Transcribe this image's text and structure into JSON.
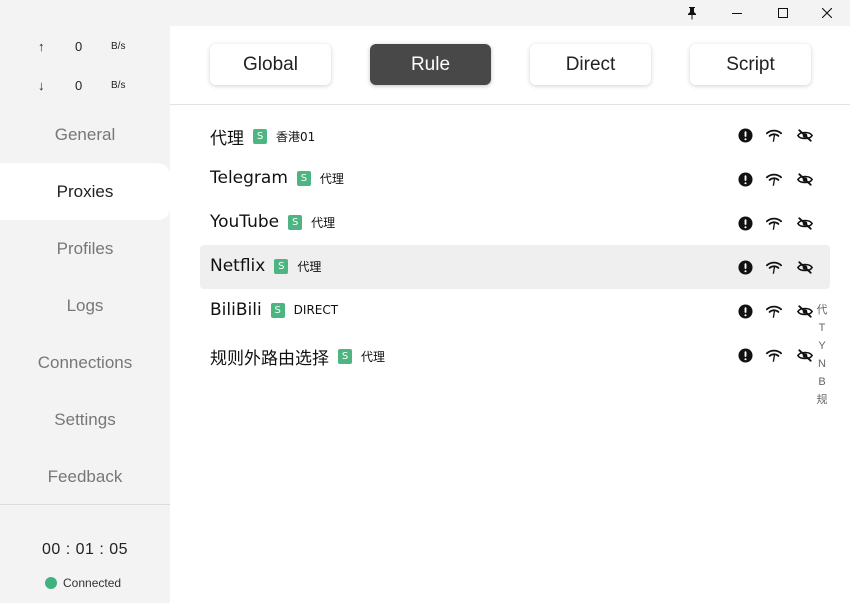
{
  "titlebar": {
    "pin_icon": "pin-icon",
    "minimize_icon": "minimize-icon",
    "maximize_icon": "maximize-icon",
    "close_icon": "close-icon"
  },
  "traffic": {
    "upload": {
      "arrow": "↑",
      "value": "0",
      "unit": "B/s"
    },
    "download": {
      "arrow": "↓",
      "value": "0",
      "unit": "B/s"
    }
  },
  "sidebar": {
    "items": [
      {
        "label": "General",
        "active": false
      },
      {
        "label": "Proxies",
        "active": true
      },
      {
        "label": "Profiles",
        "active": false
      },
      {
        "label": "Logs",
        "active": false
      },
      {
        "label": "Connections",
        "active": false
      },
      {
        "label": "Settings",
        "active": false
      },
      {
        "label": "Feedback",
        "active": false
      }
    ],
    "timer": "00 : 01 : 05",
    "status": "Connected",
    "status_color": "#3fb27f"
  },
  "modes": [
    {
      "label": "Global",
      "active": false
    },
    {
      "label": "Rule",
      "active": true
    },
    {
      "label": "Direct",
      "active": false
    },
    {
      "label": "Script",
      "active": false
    }
  ],
  "groups": [
    {
      "name": "代理",
      "type": "S",
      "selected": "香港01"
    },
    {
      "name": "Telegram",
      "type": "S",
      "selected": "代理"
    },
    {
      "name": "YouTube",
      "type": "S",
      "selected": "代理"
    },
    {
      "name": "Netflix",
      "type": "S",
      "selected": "代理"
    },
    {
      "name": "BiliBili",
      "type": "S",
      "selected": "DIRECT"
    },
    {
      "name": "规则外路由选择",
      "type": "S",
      "selected": "代理"
    }
  ],
  "group_actions": [
    "info-icon",
    "latency-test-icon",
    "hide-icon"
  ],
  "index_bar": [
    "代",
    "T",
    "Y",
    "N",
    "B",
    "规"
  ],
  "colors": {
    "accent_badge": "#4cb581",
    "active_mode": "#484848",
    "highlight_row": "#efefef"
  }
}
